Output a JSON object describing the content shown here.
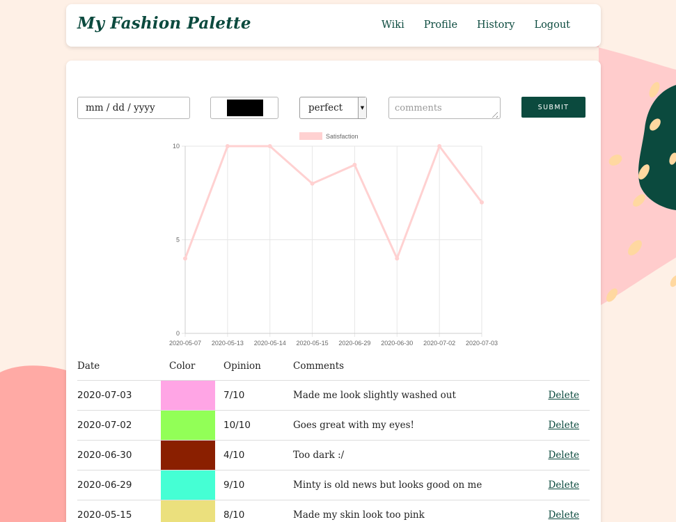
{
  "nav": {
    "brand": "My Fashion Palette",
    "links": [
      "Wiki",
      "Profile",
      "History",
      "Logout"
    ]
  },
  "form": {
    "date_placeholder": "mm / dd / yyyy",
    "color_value": "#000000",
    "opinion_selected": "perfect",
    "comments_placeholder": "comments",
    "submit_label": "SUBMIT"
  },
  "chart_data": {
    "type": "line",
    "categories": [
      "2020-05-07",
      "2020-05-13",
      "2020-05-14",
      "2020-05-15",
      "2020-06-29",
      "2020-06-30",
      "2020-07-02",
      "2020-07-03"
    ],
    "series": [
      {
        "name": "Satisfaction",
        "values": [
          4,
          10,
          10,
          8,
          9,
          4,
          10,
          7
        ],
        "color": "#ffd1d1"
      }
    ],
    "ylim": [
      0,
      10
    ],
    "yticks": [
      "0",
      "5",
      "10"
    ],
    "legend": "top",
    "grid": true
  },
  "table": {
    "headers": [
      "Date",
      "Color",
      "Opinion",
      "Comments"
    ],
    "delete_label": "Delete",
    "rows": [
      {
        "date": "2020-07-03",
        "color": "#ffa5e5",
        "opinion": "7/10",
        "comment": "Made me look slightly washed out"
      },
      {
        "date": "2020-07-02",
        "color": "#92ff57",
        "opinion": "10/10",
        "comment": "Goes great with my eyes!"
      },
      {
        "date": "2020-06-30",
        "color": "#8a1f00",
        "opinion": "4/10",
        "comment": "Too dark :/"
      },
      {
        "date": "2020-06-29",
        "color": "#45ffd4",
        "opinion": "9/10",
        "comment": "Minty is old news but looks good on me"
      },
      {
        "date": "2020-05-15",
        "color": "#ebe07d",
        "opinion": "8/10",
        "comment": "Made my skin look too pink"
      }
    ]
  },
  "colors": {
    "brand": "#0b4a3e",
    "background": "#fef0e6",
    "blob_pink": "#ffcccc",
    "blob_coral": "#ffaaa5",
    "blob_green": "#0b4a3e",
    "seed": "#ffd8a0"
  }
}
